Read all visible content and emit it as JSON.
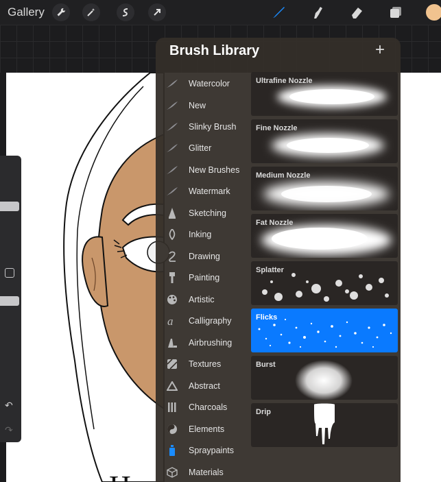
{
  "topbar": {
    "gallery_label": "Gallery",
    "left_tools": [
      "wrench-icon",
      "magic-wand-icon",
      "selection-icon",
      "transform-arrow-icon"
    ],
    "right_tools": [
      "brush-icon",
      "smudge-icon",
      "eraser-icon",
      "layers-icon"
    ],
    "current_color": "#f1c38f"
  },
  "panel": {
    "title": "Brush Library",
    "add_label": "+"
  },
  "categories": [
    {
      "label": "Watercolor",
      "icon": "brush-stroke-icon"
    },
    {
      "label": "New",
      "icon": "brush-stroke-icon"
    },
    {
      "label": "Slinky Brush",
      "icon": "brush-stroke-icon"
    },
    {
      "label": "Glitter",
      "icon": "brush-stroke-icon"
    },
    {
      "label": "New Brushes",
      "icon": "brush-stroke-icon"
    },
    {
      "label": "Watermark",
      "icon": "brush-stroke-icon"
    },
    {
      "label": "Sketching",
      "icon": "pencil-tip-icon"
    },
    {
      "label": "Inking",
      "icon": "ink-nib-icon"
    },
    {
      "label": "Drawing",
      "icon": "squiggle-icon"
    },
    {
      "label": "Painting",
      "icon": "paint-brush-icon"
    },
    {
      "label": "Artistic",
      "icon": "palette-icon"
    },
    {
      "label": "Calligraphy",
      "icon": "calligraphy-icon"
    },
    {
      "label": "Airbrushing",
      "icon": "airbrush-icon"
    },
    {
      "label": "Textures",
      "icon": "texture-icon"
    },
    {
      "label": "Abstract",
      "icon": "triangle-icon"
    },
    {
      "label": "Charcoals",
      "icon": "charcoal-icon"
    },
    {
      "label": "Elements",
      "icon": "yin-yang-icon"
    },
    {
      "label": "Spraypaints",
      "icon": "spray-can-icon"
    },
    {
      "label": "Materials",
      "icon": "cube-icon"
    }
  ],
  "brushes": [
    {
      "name": "Ultrafine Nozzle",
      "selected": false
    },
    {
      "name": "Fine Nozzle",
      "selected": false
    },
    {
      "name": "Medium Nozzle",
      "selected": false
    },
    {
      "name": "Fat Nozzle",
      "selected": false
    },
    {
      "name": "Splatter",
      "selected": false
    },
    {
      "name": "Flicks",
      "selected": true
    },
    {
      "name": "Burst",
      "selected": false
    },
    {
      "name": "Drip",
      "selected": false
    }
  ],
  "canvas_text": "How",
  "colors": {
    "accent": "#0a7aff",
    "skin": "#c9976b"
  }
}
